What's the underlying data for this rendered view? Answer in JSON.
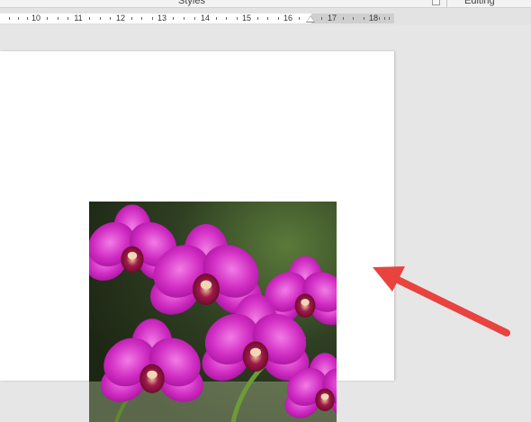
{
  "ribbon": {
    "groups": [
      {
        "label": "Styles"
      },
      {
        "label": "Editing"
      }
    ]
  },
  "ruler": {
    "numbers": [
      "10",
      "11",
      "12",
      "13",
      "14",
      "15",
      "16",
      "17",
      "18"
    ]
  },
  "image": {
    "subject": "magenta orchid flowers",
    "colors": {
      "petal": "#c21fb5",
      "petal_light": "#e24fd4",
      "center": "#8a0f3c",
      "leaf": "#3d6b22",
      "background": "#2f3f22"
    }
  },
  "annotation": {
    "arrow_color": "#e8433e"
  }
}
